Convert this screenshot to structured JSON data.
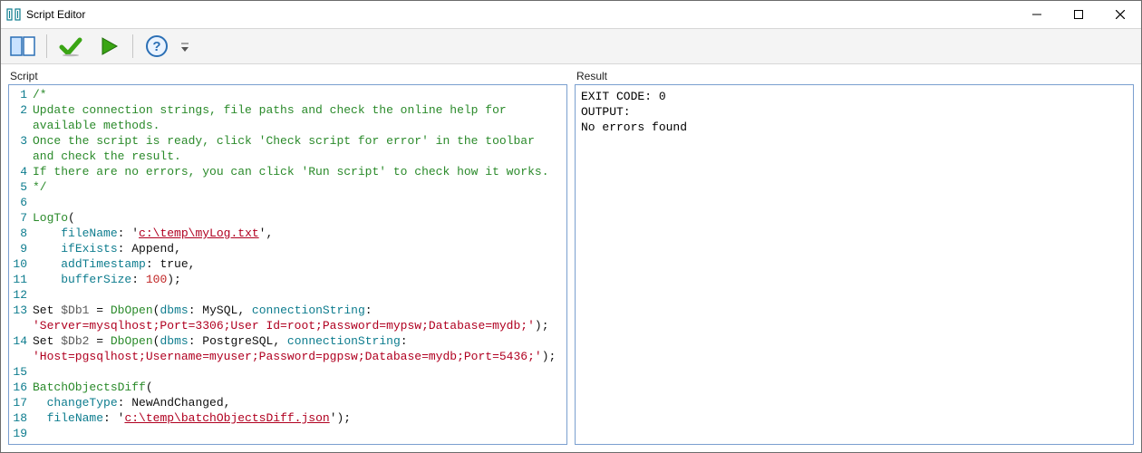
{
  "window": {
    "title": "Script Editor"
  },
  "panels": {
    "script_label": "Script",
    "result_label": "Result"
  },
  "toolbar": {
    "toggle_label": "Toggle panels",
    "check_label": "Check script for errors",
    "run_label": "Run script",
    "help_label": "Help"
  },
  "result": {
    "line1": "EXIT CODE: 0",
    "line2": "OUTPUT:",
    "line3": "No errors found"
  },
  "script": {
    "l1": "/*",
    "l2": "Update connection strings, file paths and check the online help for available methods.",
    "l3": "Once the script is ready, click 'Check script for error' in the toolbar and check the result.",
    "l4": "If there are no errors, you can click 'Run script' to check how it works.",
    "l5": "*/",
    "l6": "",
    "l7_fn": "LogTo",
    "l7_open": "(",
    "l8_p": "fileName",
    "l8_colon": ": '",
    "l8_v": "c:\\temp\\myLog.txt",
    "l8_end": "',",
    "l9_p": "ifExists",
    "l9_colon": ": ",
    "l9_v": "Append",
    "l9_end": ",",
    "l10_p": "addTimestamp",
    "l10_colon": ": ",
    "l10_v": "true",
    "l10_end": ",",
    "l11_p": "bufferSize",
    "l11_colon": ": ",
    "l11_v": "100",
    "l11_end": ");",
    "l12": "",
    "l13_set": "Set ",
    "l13_var": "$Db1",
    "l13_eq": " = ",
    "l13_fn": "DbOpen",
    "l13_open": "(",
    "l13_p1": "dbms",
    "l13_c1": ": ",
    "l13_v1": "MySQL",
    "l13_comma": ", ",
    "l13_p2": "connectionString",
    "l13_c2": ": ",
    "l13w_str": "'Server=mysqlhost;Port=3306;User Id=root;Password=mypsw;Database=mydb;'",
    "l13w_end": ");",
    "l14_set": "Set ",
    "l14_var": "$Db2",
    "l14_eq": " = ",
    "l14_fn": "DbOpen",
    "l14_open": "(",
    "l14_p1": "dbms",
    "l14_c1": ": ",
    "l14_v1": "PostgreSQL",
    "l14_comma": ", ",
    "l14_p2": "connectionString",
    "l14_c2": ": ",
    "l14w_str": "'Host=pgsqlhost;Username=myuser;Password=pgpsw;Database=mydb;Port=5436;'",
    "l14w_end": ");",
    "l15": "",
    "l16_fn": "BatchObjectsDiff",
    "l16_open": "(",
    "l17_p": "changeType",
    "l17_colon": ": ",
    "l17_v": "NewAndChanged",
    "l17_end": ",",
    "l18_p": "fileName",
    "l18_colon": ": '",
    "l18_v": "c:\\temp\\batchObjectsDiff.json",
    "l18_end": "');",
    "l19": ""
  },
  "gutter": {
    "n1": "1",
    "n2": "2",
    "n3": "3",
    "n4": "4",
    "n5": "5",
    "n6": "6",
    "n7": "7",
    "n8": "8",
    "n9": "9",
    "n10": "10",
    "n11": "11",
    "n12": "12",
    "n13": "13",
    "n14": "14",
    "n15": "15",
    "n16": "16",
    "n17": "17",
    "n18": "18",
    "n19": "19"
  }
}
